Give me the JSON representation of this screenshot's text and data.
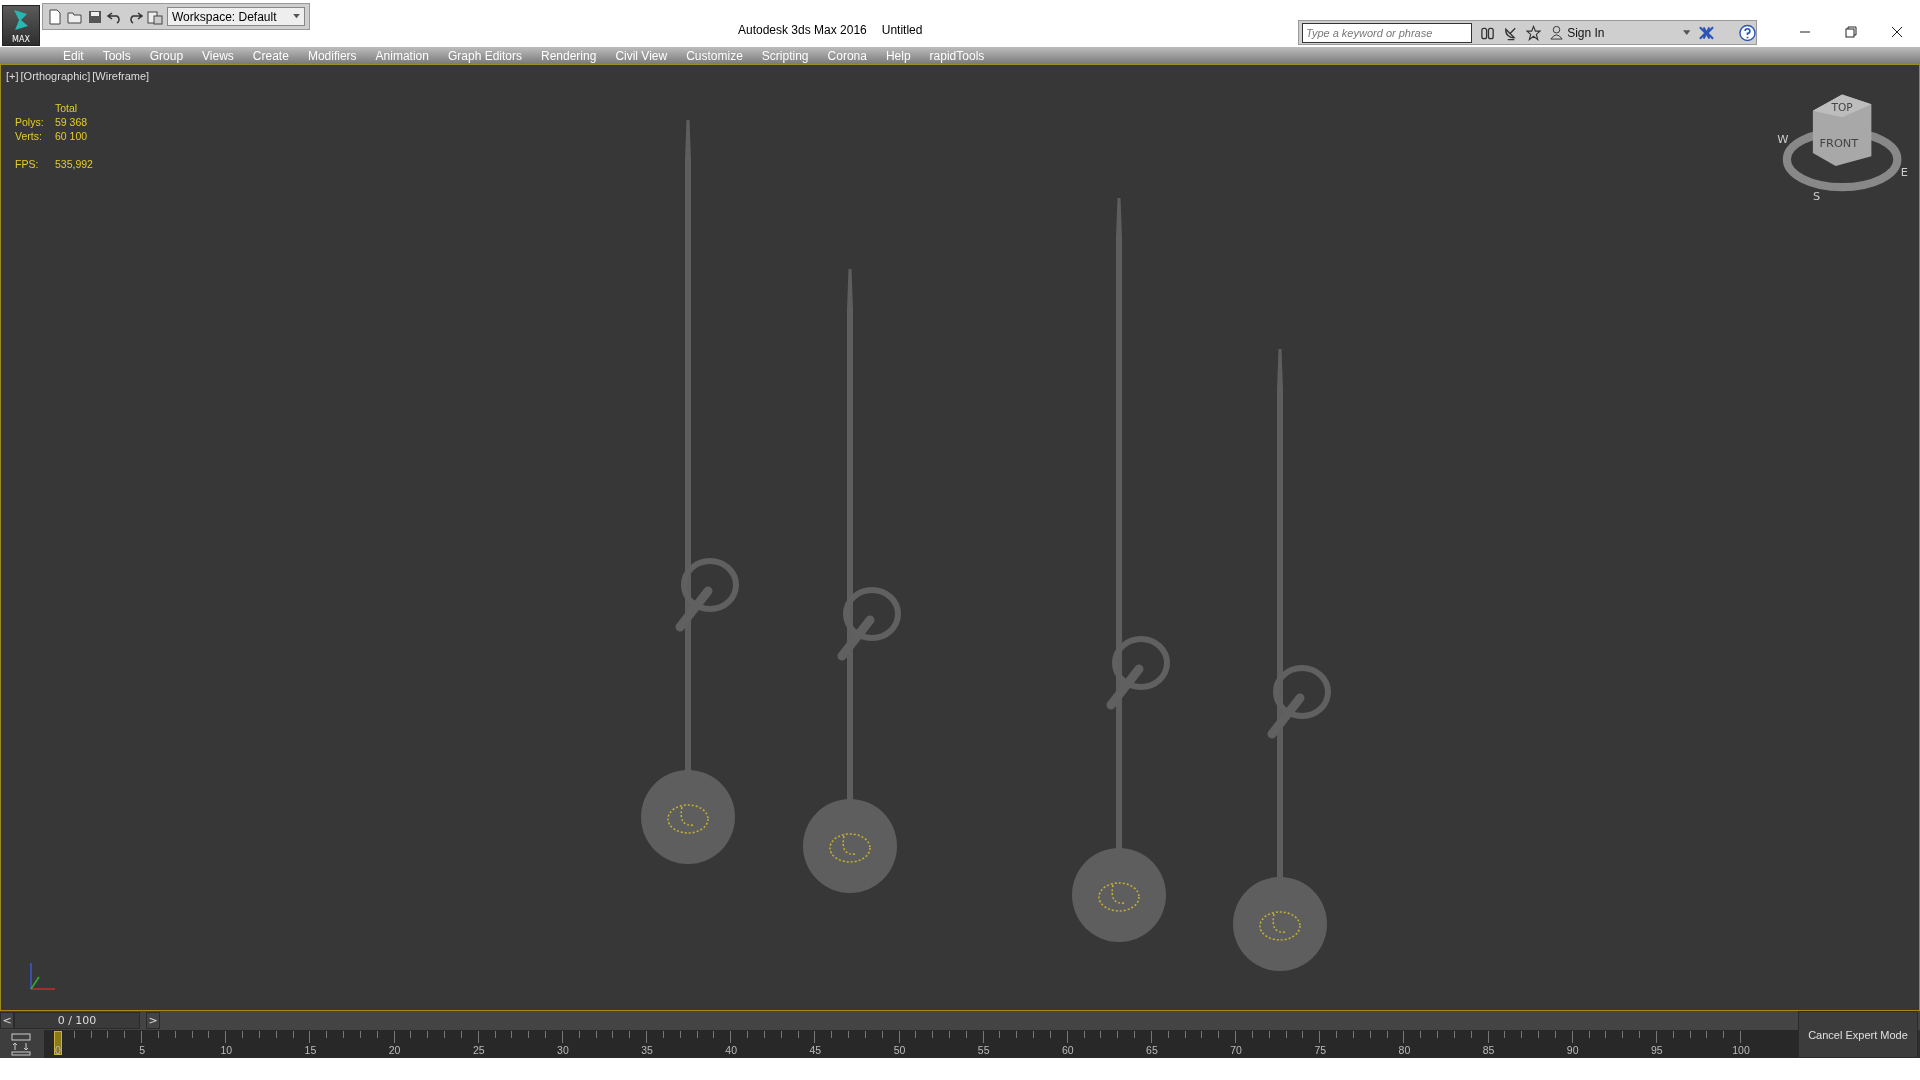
{
  "app_button": {
    "label": "MAX"
  },
  "workspace": {
    "value": "Workspace: Default"
  },
  "window": {
    "app": "Autodesk 3ds Max 2016",
    "document": "Untitled"
  },
  "search": {
    "placeholder": "Type a keyword or phrase"
  },
  "sign_in": "Sign In",
  "menu": [
    "Edit",
    "Tools",
    "Group",
    "Views",
    "Create",
    "Modifiers",
    "Animation",
    "Graph Editors",
    "Rendering",
    "Civil View",
    "Customize",
    "Scripting",
    "Corona",
    "Help",
    "rapidTools"
  ],
  "viewport": {
    "labels": [
      "[+]",
      "[Orthographic]",
      "[Wireframe]"
    ],
    "stats": {
      "header": "Total",
      "rows": [
        {
          "label": "Polys:",
          "value": "59 368"
        },
        {
          "label": "Verts:",
          "value": "60 100"
        }
      ],
      "fps_label": "FPS:",
      "fps_value": "535,992"
    },
    "viewcube": {
      "top": "TOP",
      "front": "FRONT",
      "compass": [
        "W",
        "E",
        "S"
      ]
    }
  },
  "time_slider": {
    "prev": "<",
    "position": "0 / 100",
    "next": ">"
  },
  "track_bar": {
    "labels": [
      "0",
      "5",
      "10",
      "15",
      "20",
      "25",
      "30",
      "35",
      "40",
      "45",
      "50",
      "55",
      "60",
      "65",
      "70",
      "75",
      "80",
      "85",
      "90",
      "95",
      "100"
    ]
  },
  "expert_mode_button": "Cancel Expert Mode"
}
